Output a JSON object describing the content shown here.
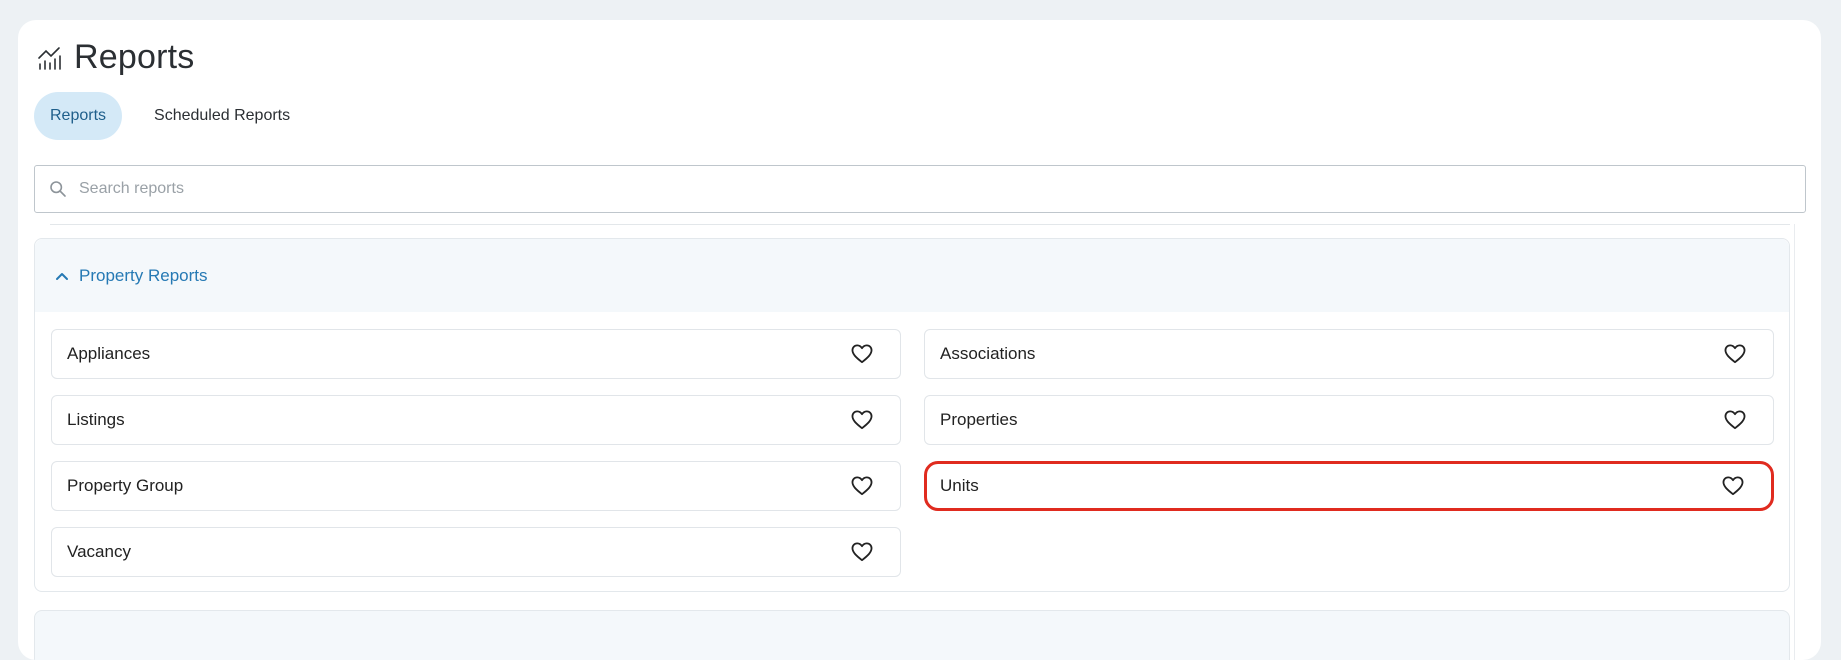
{
  "page": {
    "title": "Reports",
    "title_icon": "chart-icon"
  },
  "tabs": [
    {
      "label": "Reports",
      "active": true
    },
    {
      "label": "Scheduled Reports",
      "active": false
    }
  ],
  "search": {
    "placeholder": "Search reports",
    "value": ""
  },
  "section": {
    "title": "Property Reports",
    "expanded": true,
    "items": [
      {
        "label": "Appliances"
      },
      {
        "label": "Associations"
      },
      {
        "label": "Listings"
      },
      {
        "label": "Properties"
      },
      {
        "label": "Property Group"
      },
      {
        "label": "Units",
        "highlighted": true
      },
      {
        "label": "Vacancy"
      }
    ]
  },
  "colors": {
    "accent": "#2579b4",
    "active_tab_bg": "#d4e9f7",
    "highlight": "#e02b1f"
  }
}
